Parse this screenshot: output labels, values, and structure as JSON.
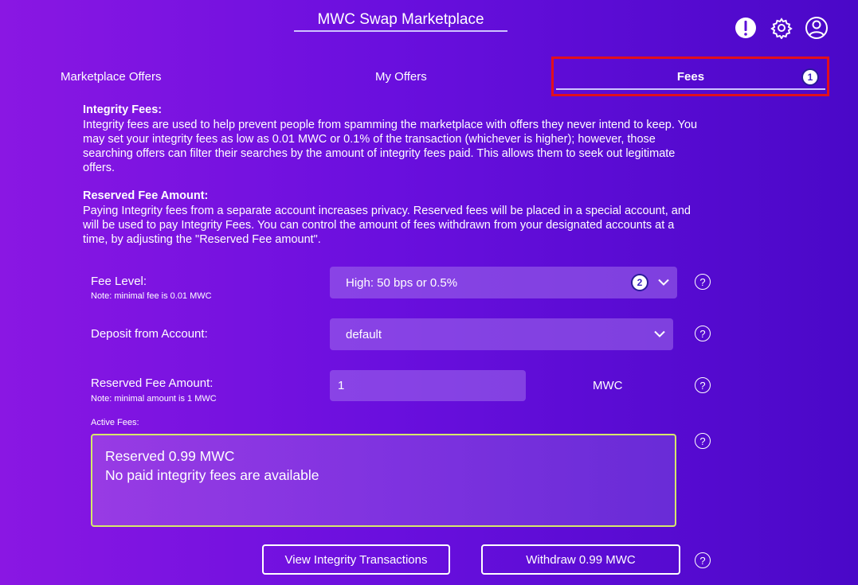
{
  "header": {
    "title": "MWC Swap Marketplace",
    "icons": [
      "alert-icon",
      "gear-icon",
      "user-icon"
    ]
  },
  "tabs": [
    {
      "label": "Marketplace Offers"
    },
    {
      "label": "My Offers"
    },
    {
      "label": "Fees",
      "selected": true,
      "badge": "1"
    }
  ],
  "integrity": {
    "title": "Integrity Fees:",
    "lines": [
      "Integrity fees are used to help prevent people from spamming the marketplace with offers they never intend to keep. You",
      "may set your integrity fees as low as 0.01 MWC or 0.1% of the transaction (whichever is higher); however, those",
      "searching offers can filter their searches by the amount of integrity fees paid. This allows them to seek out legitimate",
      "offers."
    ]
  },
  "reserved": {
    "title": "Reserved Fee Amount:",
    "lines": [
      "Paying Integrity fees from a separate account increases privacy. Reserved fees will be placed in a special account, and",
      "will be used to pay Integrity Fees. You can control the amount of fees withdrawn from your designated accounts at a",
      "time, by adjusting the \"Reserved Fee amount\"."
    ]
  },
  "form": {
    "fee_level": {
      "label": "Fee Level:",
      "note": "Note: minimal fee is 0.01 MWC",
      "value": "High: 50 bps or 0.5%",
      "badge": "2"
    },
    "deposit": {
      "label": "Deposit from Account:",
      "value": "default"
    },
    "reserved_amount": {
      "label": "Reserved Fee Amount:",
      "note": "Note: minimal amount is 1 MWC",
      "value": "1",
      "unit": "MWC"
    },
    "active_fees": {
      "label": "Active Fees:",
      "line1": "Reserved 0.99 MWC",
      "line2": "No paid integrity fees are available"
    }
  },
  "buttons": {
    "view_tx": "View Integrity Transactions",
    "withdraw": "Withdraw 0.99 MWC"
  },
  "help_glyph": "?",
  "colors": {
    "highlight": "#e2101c",
    "active_border": "#d6e86a"
  }
}
